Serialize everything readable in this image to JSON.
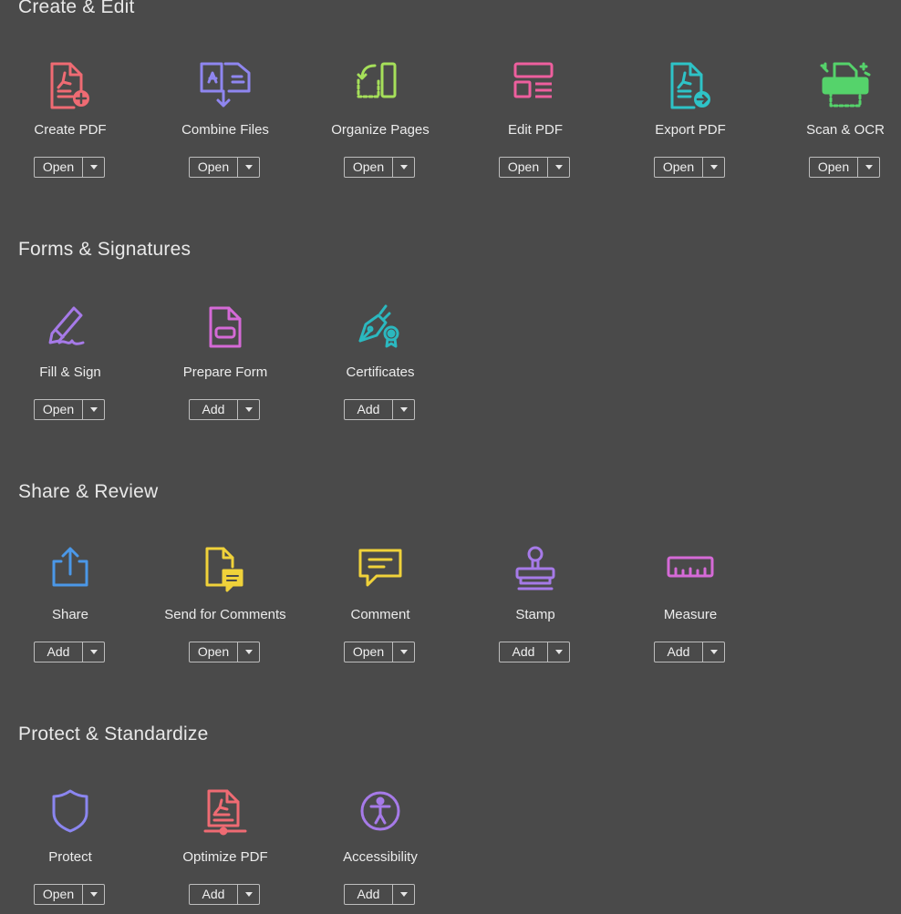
{
  "sections": [
    {
      "title": "Create & Edit",
      "tools": [
        {
          "label": "Create PDF",
          "action": "Open",
          "icon": "create-pdf-icon",
          "color": "#ef6b73"
        },
        {
          "label": "Combine Files",
          "action": "Open",
          "icon": "combine-files-icon",
          "color": "#8f86f0"
        },
        {
          "label": "Organize Pages",
          "action": "Open",
          "icon": "organize-pages-icon",
          "color": "#a6e05a"
        },
        {
          "label": "Edit PDF",
          "action": "Open",
          "icon": "edit-pdf-icon",
          "color": "#ee5f9e"
        },
        {
          "label": "Export PDF",
          "action": "Open",
          "icon": "export-pdf-icon",
          "color": "#2ec3c7"
        },
        {
          "label": "Scan & OCR",
          "action": "Open",
          "icon": "scan-ocr-icon",
          "color": "#55d36b"
        }
      ]
    },
    {
      "title": "Forms & Signatures",
      "tools": [
        {
          "label": "Fill & Sign",
          "action": "Open",
          "icon": "fill-sign-icon",
          "color": "#a67ae8"
        },
        {
          "label": "Prepare Form",
          "action": "Add",
          "icon": "prepare-form-icon",
          "color": "#d56ad7"
        },
        {
          "label": "Certificates",
          "action": "Add",
          "icon": "certificates-icon",
          "color": "#2bb8bf"
        }
      ]
    },
    {
      "title": "Share & Review",
      "tools": [
        {
          "label": "Share",
          "action": "Add",
          "icon": "share-icon",
          "color": "#4b98e8"
        },
        {
          "label": "Send for Comments",
          "action": "Open",
          "icon": "send-for-comments-icon",
          "color": "#f0d23a"
        },
        {
          "label": "Comment",
          "action": "Open",
          "icon": "comment-icon",
          "color": "#f0d23a"
        },
        {
          "label": "Stamp",
          "action": "Add",
          "icon": "stamp-icon",
          "color": "#a67ae8"
        },
        {
          "label": "Measure",
          "action": "Add",
          "icon": "measure-icon",
          "color": "#d56ad7"
        }
      ]
    },
    {
      "title": "Protect & Standardize",
      "tools": [
        {
          "label": "Protect",
          "action": "Open",
          "icon": "protect-icon",
          "color": "#8b86f0"
        },
        {
          "label": "Optimize PDF",
          "action": "Add",
          "icon": "optimize-pdf-icon",
          "color": "#ef6b73"
        },
        {
          "label": "Accessibility",
          "action": "Add",
          "icon": "accessibility-icon",
          "color": "#a67ae8"
        }
      ]
    }
  ]
}
